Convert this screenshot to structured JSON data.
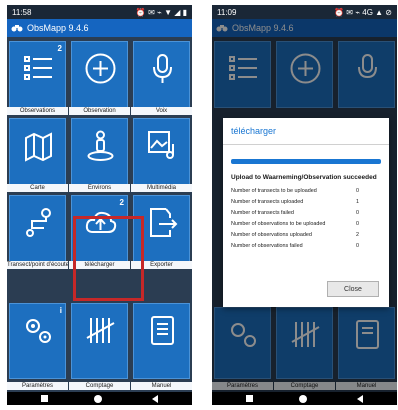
{
  "colors": {
    "tile": "#1d6fbf",
    "appbar": "#1565c0",
    "status": "#1a2736",
    "highlight": "#c62828",
    "dialog_accent": "#1976d2"
  },
  "left": {
    "status": {
      "time": "11:58",
      "icons": "⏰ ✉ ⌁ ▼ ◢ ▮"
    },
    "app_title": "ObsMapp 9.4.6",
    "tiles": [
      {
        "label": "Observations",
        "badge": "2",
        "icon": "list-icon"
      },
      {
        "label": "Observation",
        "badge": "",
        "icon": "plus-circle-icon"
      },
      {
        "label": "Voix",
        "badge": "",
        "icon": "microphone-icon"
      },
      {
        "label": "Carte",
        "badge": "",
        "icon": "map-icon"
      },
      {
        "label": "Environs",
        "badge": "",
        "icon": "person-location-icon"
      },
      {
        "label": "Multimédia",
        "badge": "",
        "icon": "media-icon"
      },
      {
        "label": "Transect/point d'écoute",
        "badge": "",
        "icon": "route-icon"
      },
      {
        "label": "télécharger",
        "badge": "2",
        "icon": "cloud-upload-icon"
      },
      {
        "label": "Exporter",
        "badge": "",
        "icon": "export-icon"
      },
      {
        "label": "Paramètres",
        "badge": "i",
        "icon": "gears-icon"
      },
      {
        "label": "Comptage",
        "badge": "",
        "icon": "tally-icon"
      },
      {
        "label": "Manuel",
        "badge": "",
        "icon": "book-icon"
      }
    ]
  },
  "right": {
    "status": {
      "time": "11:09",
      "icons": "⏰ ✉ ⌁ 4G ▲ ⊘"
    },
    "app_title": "ObsMapp 9.4.6",
    "bg_labels": [
      "Paramètres",
      "Comptage",
      "Manuel"
    ],
    "dialog": {
      "title": "télécharger",
      "progress": 1.0,
      "heading": "Upload to Waarneming/Observation succeeded",
      "rows": [
        {
          "label": "Number of transects to be uploaded",
          "value": "0"
        },
        {
          "label": "Number of transects uploaded",
          "value": "1"
        },
        {
          "label": "Number of transects failed",
          "value": "0"
        },
        {
          "label": "Number of observations to be uploaded",
          "value": "0"
        },
        {
          "label": "Number of observations uploaded",
          "value": "2"
        },
        {
          "label": "Number of observations failed",
          "value": "0"
        }
      ],
      "close_label": "Close"
    }
  }
}
